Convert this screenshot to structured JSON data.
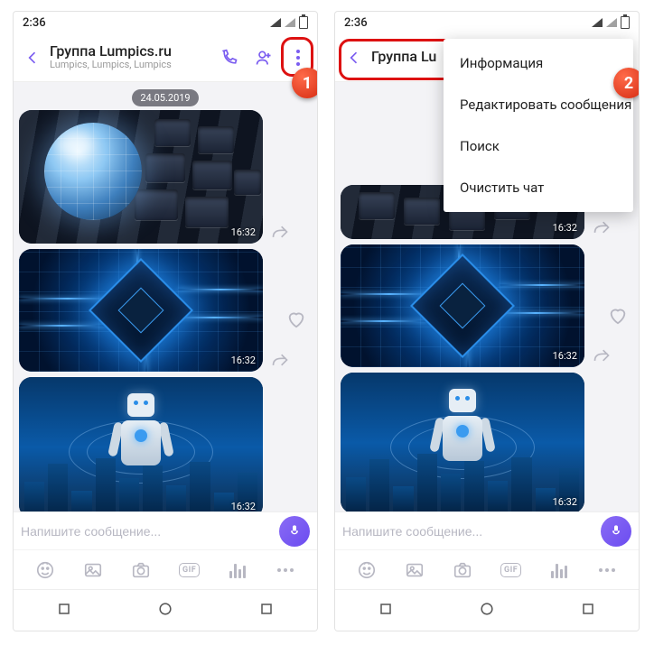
{
  "status": {
    "time": "2:36"
  },
  "appbar": {
    "title": "Группа Lumpics.ru",
    "subtitle": "Lumpics, Lumpics, Lumpics",
    "title2": "Группа Lu"
  },
  "chat": {
    "date_chip": "24.05.2019",
    "msg_time": "16:32"
  },
  "composer": {
    "placeholder": "Напишите сообщение..."
  },
  "attach": {
    "gif_label": "GIF"
  },
  "menu": {
    "info": "Информация",
    "edit": "Редактировать сообщения",
    "search": "Поиск",
    "clear": "Очистить чат"
  },
  "callouts": {
    "step1": "1",
    "step2": "2"
  }
}
